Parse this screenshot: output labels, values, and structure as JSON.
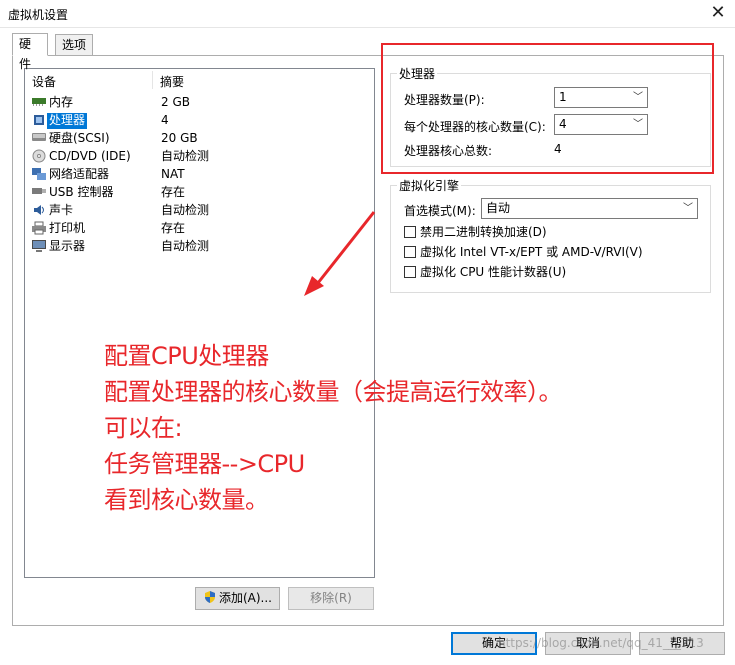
{
  "window": {
    "title": "虚拟机设置",
    "close_glyph": "✕"
  },
  "tabs": [
    {
      "label": "硬件"
    },
    {
      "label": "选项"
    }
  ],
  "device_list": {
    "headers": {
      "device": "设备",
      "summary": "摘要"
    },
    "rows": [
      {
        "icon": "memory-icon",
        "name": "内存",
        "summary": "2 GB"
      },
      {
        "icon": "processor-icon",
        "name": "处理器",
        "summary": "4"
      },
      {
        "icon": "harddisk-icon",
        "name": "硬盘(SCSI)",
        "summary": "20 GB"
      },
      {
        "icon": "cd-dvd-icon",
        "name": "CD/DVD (IDE)",
        "summary": "自动检测"
      },
      {
        "icon": "network-adapter-icon",
        "name": "网络适配器",
        "summary": "NAT"
      },
      {
        "icon": "usb-icon",
        "name": "USB 控制器",
        "summary": "存在"
      },
      {
        "icon": "sound-card-icon",
        "name": "声卡",
        "summary": "自动检测"
      },
      {
        "icon": "printer-icon",
        "name": "打印机",
        "summary": "存在"
      },
      {
        "icon": "display-icon",
        "name": "显示器",
        "summary": "自动检测"
      }
    ],
    "selected_index": 1,
    "add_button": "添加(A)...",
    "remove_button": "移除(R)"
  },
  "processors": {
    "group_title": "处理器",
    "count_label": "处理器数量(P):",
    "count_value": "1",
    "cores_label": "每个处理器的核心数量(C):",
    "cores_value": "4",
    "total_label": "处理器核心总数:",
    "total_value": "4"
  },
  "virtualization": {
    "group_title": "虚拟化引擎",
    "mode_label": "首选模式(M):",
    "mode_value": "自动",
    "options": [
      {
        "label": "禁用二进制转换加速(D)",
        "checked": false
      },
      {
        "label": "虚拟化 Intel VT-x/EPT 或 AMD-V/RVI(V)",
        "checked": false
      },
      {
        "label": "虚拟化 CPU 性能计数器(U)",
        "checked": false
      }
    ]
  },
  "footer": {
    "ok": "确定",
    "cancel": "取消",
    "help": "帮助"
  },
  "annotation": {
    "color": "#e8272b",
    "lines": [
      "配置CPU处理器",
      "配置处理器的核心数量（会提高运行效率）。",
      "可以在:",
      "任务管理器-->CPU",
      "看到核心数量。"
    ]
  },
  "watermark": "https://blog.csdn.net/qq_41___713",
  "colors": {
    "selection": "#0078d7",
    "highlight_box": "#e8272b"
  }
}
